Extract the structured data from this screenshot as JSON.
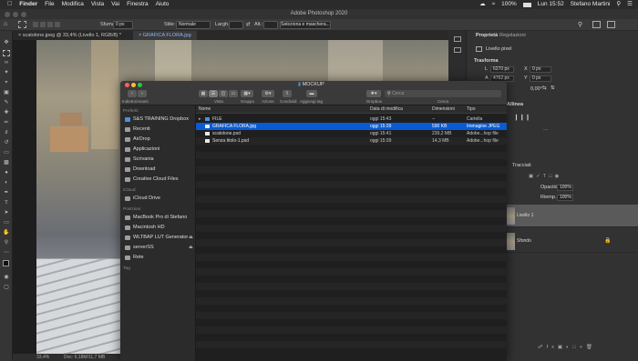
{
  "menubar": {
    "app": "Finder",
    "items": [
      "File",
      "Modifica",
      "Vista",
      "Vai",
      "Finestra",
      "Aiuto"
    ],
    "battery": "100%",
    "clock": "Lun 15:52",
    "user": "Stefano Martini"
  },
  "ps": {
    "title": "Adobe Photoshop 2020",
    "options": {
      "sfuma_label": "Sfuma:",
      "sfuma_value": "0 px",
      "stile_label": "Stile:",
      "stile_value": "Normale",
      "larg_label": "Largh.:",
      "alt_label": "Alt.:",
      "select_button": "Seleziona e maschera..."
    },
    "tabs": [
      "scatolone.jpeg @ 33,4% (Livello 1, RGB/8) *",
      "GRAFICA FLORA.jpg"
    ],
    "status": {
      "zoom": "33,4%",
      "doc": "Doc: 6,18M/11,7 MB"
    }
  },
  "panels": {
    "tab_properties": "Proprietà",
    "tab_adjustments": "Regolazioni",
    "pixel_layer": "Livello pixel",
    "transform_header": "Trasforma",
    "w_label": "L",
    "w_value": "6270 px",
    "h_label": "A",
    "h_value": "4762 px",
    "x_label": "X",
    "x_value": "0 px",
    "y_label": "Y",
    "y_value": "0 px",
    "angle": "0,00°",
    "align_header": "Allinea",
    "paths_label": "Tracciati",
    "opacity_label": "Opacità:",
    "opacity_value": "100%",
    "fill_label": "Riemp.:",
    "fill_value": "100%",
    "layers": [
      "Livello 1",
      "Sfondo"
    ]
  },
  "finder": {
    "title": "MOCKUP",
    "toolbar": {
      "nav_caption": "Indietro/Avanti",
      "view_caption": "Vista",
      "group_caption": "Gruppo",
      "action_caption": "Azione",
      "share_caption": "Condividi",
      "tag_caption": "Aggiungi tag",
      "dropbox_caption": "Dropbox",
      "search_caption": "Cerca",
      "search_placeholder": "Cerca"
    },
    "sidebar": {
      "favorites_header": "Preferiti",
      "favorites": [
        "S&S TRAINING Dropbox",
        "Recenti",
        "AirDrop",
        "Applicazioni",
        "Scrivania",
        "Download",
        "Creative Cloud Files"
      ],
      "icloud_header": "iCloud",
      "icloud": [
        "iCloud Drive"
      ],
      "locations_header": "Posizioni",
      "locations": [
        "MacBook Pro di Stefano",
        "Macintosh HD",
        "WLTBAP LUT Generator",
        "serverSS",
        "Rete"
      ],
      "tags_header": "Tag"
    },
    "columns": {
      "name": "Nome",
      "date": "Data di modifica",
      "size": "Dimensioni",
      "kind": "Tipo"
    },
    "rows": [
      {
        "name": "FILE",
        "date": "oggi 15:43",
        "size": "--",
        "kind": "Cartella"
      },
      {
        "name": "GRAFICA FLORA.jpg",
        "date": "oggi 15:39",
        "size": "590 KB",
        "kind": "Immagine JPEG"
      },
      {
        "name": "scatolone.psd",
        "date": "oggi 15:41",
        "size": "239,2 MB",
        "kind": "Adobe...hop file"
      },
      {
        "name": "Senza titolo-1.psd",
        "date": "oggi 15:39",
        "size": "14,3 MB",
        "kind": "Adobe...hop file"
      }
    ]
  }
}
